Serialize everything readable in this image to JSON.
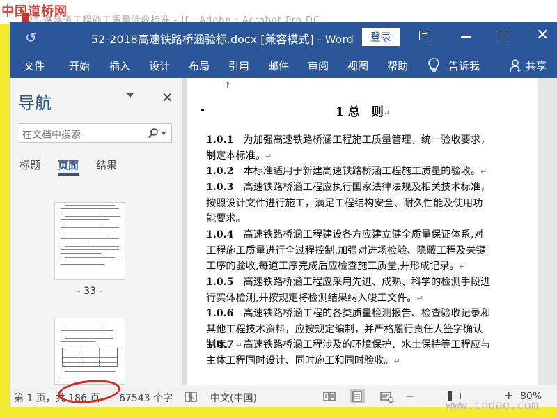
{
  "watermarks": {
    "top_left": "中国道桥网",
    "bottom_right": "www.cndao.com"
  },
  "background_window": {
    "title": "12铁路隧道工程施工质量验收标准 - If · Adobe · Acrobat Pro DC"
  },
  "titlebar": {
    "document_title": "52-2018高速铁路桥涵验标.docx [兼容模式] - Word",
    "login_label": "登录"
  },
  "ribbon": {
    "tabs": [
      "文件",
      "开始",
      "插入",
      "设计",
      "布局",
      "引用",
      "邮件",
      "审阅",
      "视图",
      "帮助"
    ],
    "tell_me": "告诉我",
    "share": "共享"
  },
  "navigation": {
    "title": "导航",
    "search_placeholder": "在文档中搜索",
    "tabs": [
      "标题",
      "页面",
      "结果"
    ],
    "active_tab": "页面",
    "thumbnails": [
      {
        "label": "- 33 -"
      },
      {
        "label": ""
      }
    ]
  },
  "document": {
    "heading": "1 总　则",
    "paragraphs": [
      {
        "num": "1.0.1",
        "text": "为加强高速铁路桥涵工程施工质量管理，统一验收要求，制定本标准。"
      },
      {
        "num": "1.0.2",
        "text": "本标准适用于新建高速铁路桥涵工程施工质量的验收。"
      },
      {
        "num": "1.0.3",
        "text": "高速铁路桥涵工程应执行国家法律法规及相关技术标准，按照设计文件进行施工，满足工程结构安全、耐久性能及使用功能要求。"
      },
      {
        "num": "1.0.4",
        "text": "高速铁路桥涵工程建设各方应建立健全质量保证体系,对工程施工质量进行全过程控制,加强对进场检验、隐蔽工程及关键工序的验收,每道工序完成后应检查施工质量,并形成记录。"
      },
      {
        "num": "1.0.5",
        "text": "高速铁路桥涵工程应采用先进、成熟、科学的检测手段进行实体检测,并按规定将检测结果纳入竣工文件。"
      },
      {
        "num": "1.0.6",
        "text": "高速铁路桥涵工程的各类质量检测报告、检查验收记录和其他工程技术资料，应按规定编制，并严格履行责任人签字确认制度。"
      },
      {
        "num": "1.0.7",
        "text": "高速铁路桥涵工程涉及的环境保护、水土保持等工程应与主体工程同时设计、同时施工和同时验收。"
      }
    ]
  },
  "statusbar": {
    "page_info": "第 1 页，共 186 页",
    "word_count": "67543 个字",
    "language": "中文(中国)",
    "zoom": "80%"
  },
  "colors": {
    "word_blue": "#2b579a",
    "frame_yellow": "#f2ea2e",
    "annotation_red": "#e0261d"
  }
}
